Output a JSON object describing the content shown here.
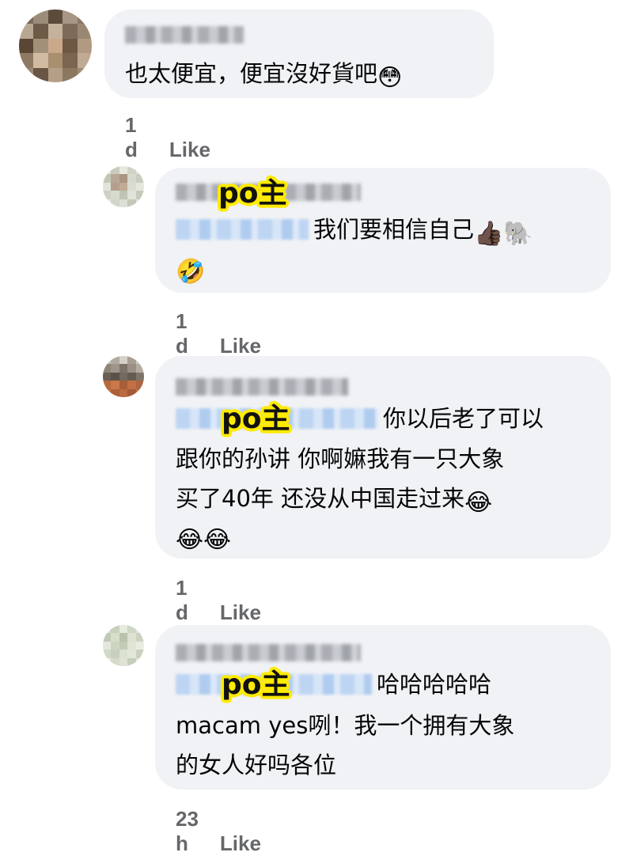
{
  "po_label": "po主",
  "comments": [
    {
      "lines": [
        "也太便宜，便宜沒好貨吧"
      ],
      "emoji_end": "😳",
      "time": "1 d",
      "like": "Like"
    },
    {
      "lines": [
        "我们要相信自己"
      ],
      "emoji_line1": "👍🏿🐘",
      "emoji_line2": "🤣",
      "time": "1 d",
      "like": "Like"
    },
    {
      "lines": [
        "你以后老了可以",
        "跟你的孙讲 你啊嫲我有一只大象",
        "买了40年 还没从中国走过来"
      ],
      "emoji_line3": "😂",
      "emoji_line4": "😂😂",
      "time": "1 d",
      "like": "Like"
    },
    {
      "lines": [
        "哈哈哈哈哈",
        "macam yes咧！我一个拥有大象",
        "的女人好吗各位"
      ],
      "time": "23 h",
      "like": "Like"
    }
  ]
}
